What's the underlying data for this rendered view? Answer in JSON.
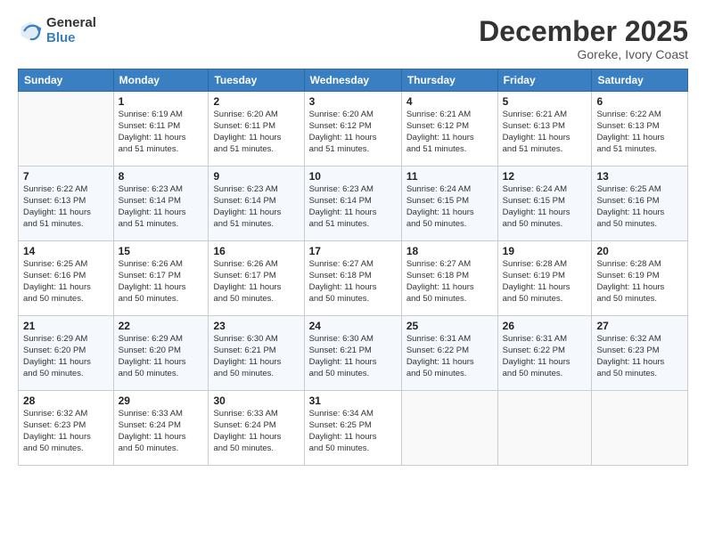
{
  "logo": {
    "general": "General",
    "blue": "Blue"
  },
  "title": "December 2025",
  "subtitle": "Goreke, Ivory Coast",
  "days_header": [
    "Sunday",
    "Monday",
    "Tuesday",
    "Wednesday",
    "Thursday",
    "Friday",
    "Saturday"
  ],
  "weeks": [
    [
      {
        "day": "",
        "info": ""
      },
      {
        "day": "1",
        "info": "Sunrise: 6:19 AM\nSunset: 6:11 PM\nDaylight: 11 hours\nand 51 minutes."
      },
      {
        "day": "2",
        "info": "Sunrise: 6:20 AM\nSunset: 6:11 PM\nDaylight: 11 hours\nand 51 minutes."
      },
      {
        "day": "3",
        "info": "Sunrise: 6:20 AM\nSunset: 6:12 PM\nDaylight: 11 hours\nand 51 minutes."
      },
      {
        "day": "4",
        "info": "Sunrise: 6:21 AM\nSunset: 6:12 PM\nDaylight: 11 hours\nand 51 minutes."
      },
      {
        "day": "5",
        "info": "Sunrise: 6:21 AM\nSunset: 6:13 PM\nDaylight: 11 hours\nand 51 minutes."
      },
      {
        "day": "6",
        "info": "Sunrise: 6:22 AM\nSunset: 6:13 PM\nDaylight: 11 hours\nand 51 minutes."
      }
    ],
    [
      {
        "day": "7",
        "info": "Sunrise: 6:22 AM\nSunset: 6:13 PM\nDaylight: 11 hours\nand 51 minutes."
      },
      {
        "day": "8",
        "info": "Sunrise: 6:23 AM\nSunset: 6:14 PM\nDaylight: 11 hours\nand 51 minutes."
      },
      {
        "day": "9",
        "info": "Sunrise: 6:23 AM\nSunset: 6:14 PM\nDaylight: 11 hours\nand 51 minutes."
      },
      {
        "day": "10",
        "info": "Sunrise: 6:23 AM\nSunset: 6:14 PM\nDaylight: 11 hours\nand 51 minutes."
      },
      {
        "day": "11",
        "info": "Sunrise: 6:24 AM\nSunset: 6:15 PM\nDaylight: 11 hours\nand 50 minutes."
      },
      {
        "day": "12",
        "info": "Sunrise: 6:24 AM\nSunset: 6:15 PM\nDaylight: 11 hours\nand 50 minutes."
      },
      {
        "day": "13",
        "info": "Sunrise: 6:25 AM\nSunset: 6:16 PM\nDaylight: 11 hours\nand 50 minutes."
      }
    ],
    [
      {
        "day": "14",
        "info": "Sunrise: 6:25 AM\nSunset: 6:16 PM\nDaylight: 11 hours\nand 50 minutes."
      },
      {
        "day": "15",
        "info": "Sunrise: 6:26 AM\nSunset: 6:17 PM\nDaylight: 11 hours\nand 50 minutes."
      },
      {
        "day": "16",
        "info": "Sunrise: 6:26 AM\nSunset: 6:17 PM\nDaylight: 11 hours\nand 50 minutes."
      },
      {
        "day": "17",
        "info": "Sunrise: 6:27 AM\nSunset: 6:18 PM\nDaylight: 11 hours\nand 50 minutes."
      },
      {
        "day": "18",
        "info": "Sunrise: 6:27 AM\nSunset: 6:18 PM\nDaylight: 11 hours\nand 50 minutes."
      },
      {
        "day": "19",
        "info": "Sunrise: 6:28 AM\nSunset: 6:19 PM\nDaylight: 11 hours\nand 50 minutes."
      },
      {
        "day": "20",
        "info": "Sunrise: 6:28 AM\nSunset: 6:19 PM\nDaylight: 11 hours\nand 50 minutes."
      }
    ],
    [
      {
        "day": "21",
        "info": "Sunrise: 6:29 AM\nSunset: 6:20 PM\nDaylight: 11 hours\nand 50 minutes."
      },
      {
        "day": "22",
        "info": "Sunrise: 6:29 AM\nSunset: 6:20 PM\nDaylight: 11 hours\nand 50 minutes."
      },
      {
        "day": "23",
        "info": "Sunrise: 6:30 AM\nSunset: 6:21 PM\nDaylight: 11 hours\nand 50 minutes."
      },
      {
        "day": "24",
        "info": "Sunrise: 6:30 AM\nSunset: 6:21 PM\nDaylight: 11 hours\nand 50 minutes."
      },
      {
        "day": "25",
        "info": "Sunrise: 6:31 AM\nSunset: 6:22 PM\nDaylight: 11 hours\nand 50 minutes."
      },
      {
        "day": "26",
        "info": "Sunrise: 6:31 AM\nSunset: 6:22 PM\nDaylight: 11 hours\nand 50 minutes."
      },
      {
        "day": "27",
        "info": "Sunrise: 6:32 AM\nSunset: 6:23 PM\nDaylight: 11 hours\nand 50 minutes."
      }
    ],
    [
      {
        "day": "28",
        "info": "Sunrise: 6:32 AM\nSunset: 6:23 PM\nDaylight: 11 hours\nand 50 minutes."
      },
      {
        "day": "29",
        "info": "Sunrise: 6:33 AM\nSunset: 6:24 PM\nDaylight: 11 hours\nand 50 minutes."
      },
      {
        "day": "30",
        "info": "Sunrise: 6:33 AM\nSunset: 6:24 PM\nDaylight: 11 hours\nand 50 minutes."
      },
      {
        "day": "31",
        "info": "Sunrise: 6:34 AM\nSunset: 6:25 PM\nDaylight: 11 hours\nand 50 minutes."
      },
      {
        "day": "",
        "info": ""
      },
      {
        "day": "",
        "info": ""
      },
      {
        "day": "",
        "info": ""
      }
    ]
  ]
}
